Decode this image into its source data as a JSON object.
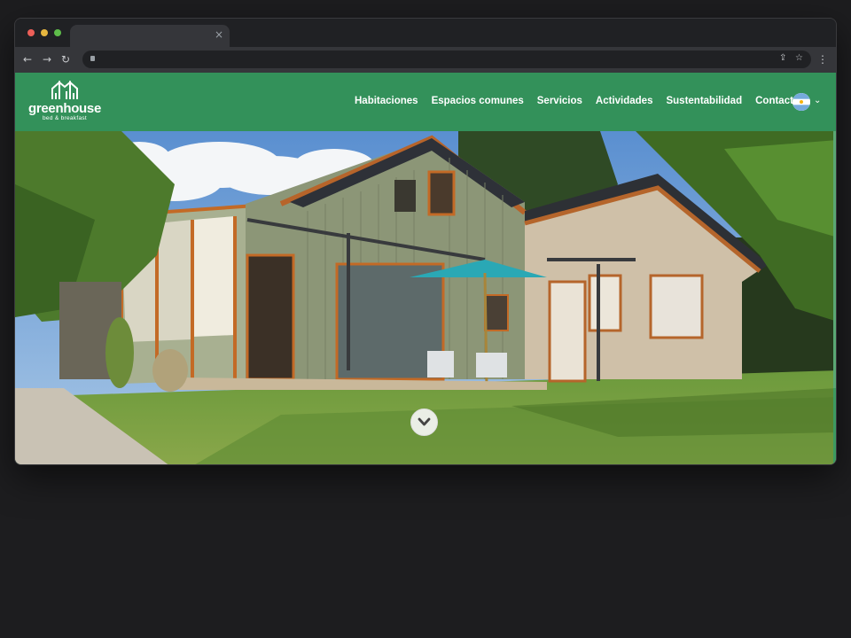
{
  "browser": {
    "tab_close": "×",
    "back": "←",
    "forward": "→",
    "reload": "↻",
    "share": "⇪",
    "star": "☆",
    "menu": "⋮"
  },
  "site": {
    "logo": {
      "name": "greenhouse",
      "tagline": "bed & breakfast"
    },
    "nav": [
      "Habitaciones",
      "Espacios comunes",
      "Servicios",
      "Actividades",
      "Sustentabilidad",
      "Contacto"
    ],
    "language_flag": "argentina-flag-icon",
    "language_chevron": "⌄"
  },
  "hero": {
    "scroll_down_icon": "chevron-down-icon"
  },
  "colors": {
    "header_green": "#33915a",
    "page_background": "#1d1d1f",
    "browser_chrome": "#202124",
    "toolbar": "#35363a"
  }
}
